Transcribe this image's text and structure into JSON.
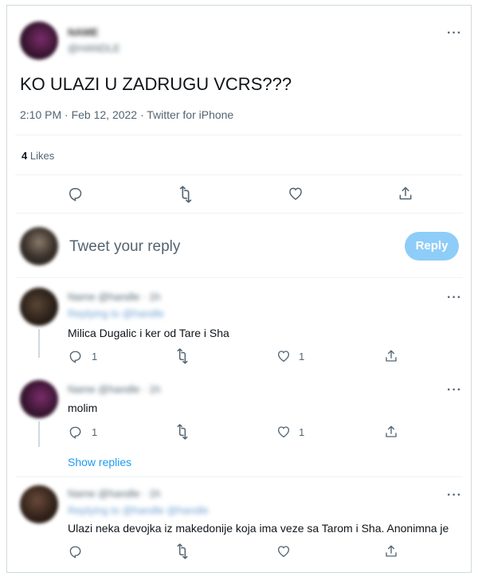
{
  "tweet": {
    "author_name": "NAME",
    "author_handle": "@HANDLE",
    "text": "KO ULAZI U ZADRUGU VCRS???",
    "meta": "2:10 PM · Feb 12, 2022 · Twitter for iPhone",
    "likes_count": "4",
    "likes_label": "Likes"
  },
  "composer": {
    "placeholder": "Tweet your reply",
    "reply_button": "Reply"
  },
  "replies": [
    {
      "author_blur": "Name @handle · 1h",
      "replying_blur": "Replying to @handle",
      "text": "Milica Dugalic i ker od Tare i Sha",
      "reply_count": "1",
      "like_count": "1"
    },
    {
      "author_blur": "Name @handle · 1h",
      "text": "molim",
      "reply_count": "1",
      "like_count": "1",
      "show_replies": "Show replies"
    },
    {
      "author_blur": "Name @handle · 1h",
      "replying_blur": "Replying to @handle @handle",
      "text": "Ulazi neka devojka iz makedonije koja ima veze sa Tarom i Sha. Anonimna je"
    }
  ],
  "icons": {
    "more": "more-icon",
    "reply": "reply-icon",
    "retweet": "retweet-icon",
    "like": "like-icon",
    "share": "share-icon"
  },
  "colors": {
    "accent": "#1d9bf0",
    "reply_button_disabled": "#8ecdf8",
    "secondary_text": "#536471"
  }
}
